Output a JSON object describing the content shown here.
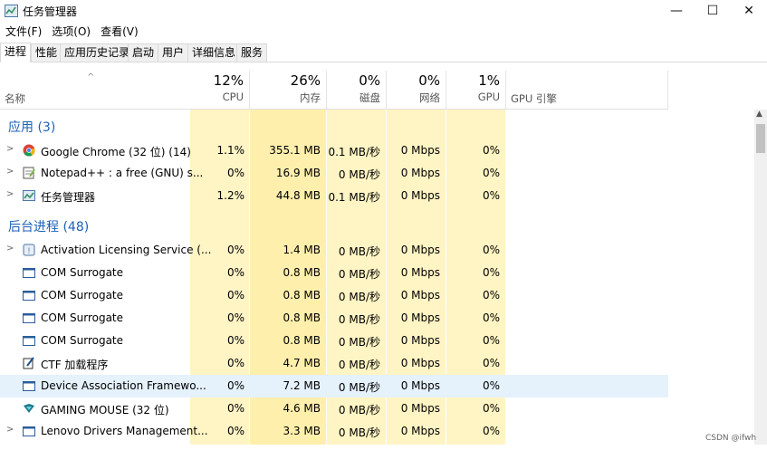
{
  "window": {
    "title": "任务管理器",
    "minimize": "—",
    "maximize": "☐",
    "close": "✕"
  },
  "menu": [
    "文件(F)",
    "选项(O)",
    "查看(V)"
  ],
  "tabs": [
    "进程",
    "性能",
    "应用历史记录",
    "启动",
    "用户",
    "详细信息",
    "服务"
  ],
  "active_tab": "进程",
  "columns": {
    "name": "名称",
    "cpu": {
      "pct": "12%",
      "label": "CPU"
    },
    "mem": {
      "pct": "26%",
      "label": "内存"
    },
    "disk": {
      "pct": "0%",
      "label": "磁盘"
    },
    "net": {
      "pct": "0%",
      "label": "网络"
    },
    "gpu": {
      "pct": "1%",
      "label": "GPU"
    },
    "gpu_engine": "GPU 引擎"
  },
  "groups": {
    "apps": "应用 (3)",
    "background": "后台进程 (48)"
  },
  "apps": [
    {
      "name": "Google Chrome (32 位) (14)",
      "cpu": "1.1%",
      "mem": "355.1 MB",
      "disk": "0.1 MB/秒",
      "net": "0 Mbps",
      "gpu": "0%",
      "icon": "chrome-icon"
    },
    {
      "name": "Notepad++ : a free (GNU) s...",
      "cpu": "0%",
      "mem": "16.9 MB",
      "disk": "0 MB/秒",
      "net": "0 Mbps",
      "gpu": "0%",
      "icon": "notepad-icon"
    },
    {
      "name": "任务管理器",
      "cpu": "1.2%",
      "mem": "44.8 MB",
      "disk": "0.1 MB/秒",
      "net": "0 Mbps",
      "gpu": "0%",
      "icon": "taskmgr-icon"
    }
  ],
  "background": [
    {
      "name": "Activation Licensing Service (...",
      "cpu": "0%",
      "mem": "1.4 MB",
      "disk": "0 MB/秒",
      "net": "0 Mbps",
      "gpu": "0%",
      "icon": "license-icon"
    },
    {
      "name": "COM Surrogate",
      "cpu": "0%",
      "mem": "0.8 MB",
      "disk": "0 MB/秒",
      "net": "0 Mbps",
      "gpu": "0%",
      "icon": "window-icon"
    },
    {
      "name": "COM Surrogate",
      "cpu": "0%",
      "mem": "0.8 MB",
      "disk": "0 MB/秒",
      "net": "0 Mbps",
      "gpu": "0%",
      "icon": "window-icon"
    },
    {
      "name": "COM Surrogate",
      "cpu": "0%",
      "mem": "0.8 MB",
      "disk": "0 MB/秒",
      "net": "0 Mbps",
      "gpu": "0%",
      "icon": "window-icon"
    },
    {
      "name": "COM Surrogate",
      "cpu": "0%",
      "mem": "0.8 MB",
      "disk": "0 MB/秒",
      "net": "0 Mbps",
      "gpu": "0%",
      "icon": "window-icon"
    },
    {
      "name": "CTF 加载程序",
      "cpu": "0%",
      "mem": "4.7 MB",
      "disk": "0 MB/秒",
      "net": "0 Mbps",
      "gpu": "0%",
      "icon": "pen-icon"
    },
    {
      "name": "Device Association Framewo...",
      "cpu": "0%",
      "mem": "7.2 MB",
      "disk": "0 MB/秒",
      "net": "0 Mbps",
      "gpu": "0%",
      "icon": "window-icon"
    },
    {
      "name": "GAMING MOUSE (32 位)",
      "cpu": "0%",
      "mem": "4.6 MB",
      "disk": "0 MB/秒",
      "net": "0 Mbps",
      "gpu": "0%",
      "icon": "mouse-icon"
    },
    {
      "name": "Lenovo Drivers Management...",
      "cpu": "0%",
      "mem": "3.3 MB",
      "disk": "0 MB/秒",
      "net": "0 Mbps",
      "gpu": "0%",
      "icon": "window-icon"
    }
  ],
  "watermark": "CSDN @ifwh",
  "colors": {
    "heat_light": "#fff4c4",
    "heat_mid": "#fff0b3",
    "group_text": "#1c61b5",
    "highlight": "#e5f1fb"
  }
}
